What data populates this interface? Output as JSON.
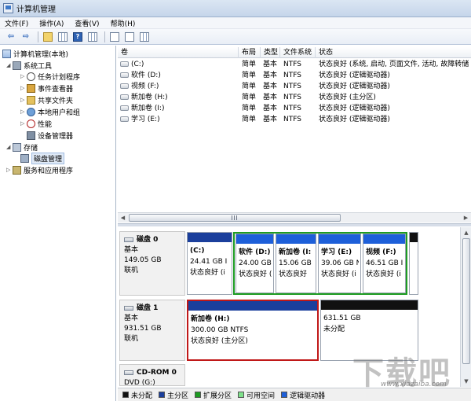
{
  "window": {
    "title": "计算机管理"
  },
  "menu": [
    "文件(F)",
    "操作(A)",
    "查看(V)",
    "帮助(H)"
  ],
  "toolbar_icons": [
    "back-arrow-icon",
    "forward-arrow-icon",
    "folder-up-icon",
    "console-tree-icon",
    "help-icon",
    "view-icon",
    "refresh-icon",
    "properties-icon",
    "settings-icon"
  ],
  "tree": {
    "root": "计算机管理(本地)",
    "system_tools": "系统工具",
    "task_scheduler": "任务计划程序",
    "event_viewer": "事件查看器",
    "shared_folders": "共享文件夹",
    "local_users": "本地用户和组",
    "performance": "性能",
    "device_manager": "设备管理器",
    "storage": "存储",
    "disk_management": "磁盘管理",
    "services_apps": "服务和应用程序"
  },
  "volume_table": {
    "headers": [
      "卷",
      "布局",
      "类型",
      "文件系统",
      "状态"
    ],
    "rows": [
      {
        "name": "(C:)",
        "layout": "简单",
        "type": "基本",
        "fs": "NTFS",
        "status": "状态良好 (系统, 启动, 页面文件, 活动, 故障转储"
      },
      {
        "name": "软件 (D:)",
        "layout": "简单",
        "type": "基本",
        "fs": "NTFS",
        "status": "状态良好 (逻辑驱动器)"
      },
      {
        "name": "视频 (F:)",
        "layout": "简单",
        "type": "基本",
        "fs": "NTFS",
        "status": "状态良好 (逻辑驱动器)"
      },
      {
        "name": "新加卷 (H:)",
        "layout": "简单",
        "type": "基本",
        "fs": "NTFS",
        "status": "状态良好 (主分区)"
      },
      {
        "name": "新加卷 (I:)",
        "layout": "简单",
        "type": "基本",
        "fs": "NTFS",
        "status": "状态良好 (逻辑驱动器)"
      },
      {
        "name": "学习 (E:)",
        "layout": "简单",
        "type": "基本",
        "fs": "NTFS",
        "status": "状态良好 (逻辑驱动器)"
      }
    ]
  },
  "disks": {
    "disk0": {
      "name": "磁盘 0",
      "type": "基本",
      "size": "149.05 GB",
      "state": "联机",
      "parts": [
        {
          "title": "(C:)",
          "size": "24.41 GB I",
          "status": "状态良好 (i"
        },
        {
          "title": "软件  (D:)",
          "size": "24.00 GB",
          "status": "状态良好 (i"
        },
        {
          "title": "新加卷  (I:",
          "size": "15.06 GB",
          "status": "状态良好"
        },
        {
          "title": "学习  (E:)",
          "size": "39.06 GB N",
          "status": "状态良好 (i"
        },
        {
          "title": "视频  (F:)",
          "size": "46.51 GB I",
          "status": "状态良好 (i"
        },
        {
          "title": "",
          "size": "",
          "status": ""
        }
      ]
    },
    "disk1": {
      "name": "磁盘 1",
      "type": "基本",
      "size": "931.51 GB",
      "state": "联机",
      "parts": [
        {
          "title": "新加卷  (H:)",
          "size": "300.00 GB NTFS",
          "status": "状态良好 (主分区)"
        },
        {
          "title": "",
          "size": "631.51 GB",
          "status": "未分配"
        }
      ]
    },
    "cdrom": {
      "name": "CD-ROM 0",
      "drive": "DVD (G:)"
    }
  },
  "legend": [
    {
      "label": "未分配",
      "color": "#111111"
    },
    {
      "label": "主分区",
      "color": "#1b3f9c"
    },
    {
      "label": "扩展分区",
      "color": "#1d9c22"
    },
    {
      "label": "可用空间",
      "color": "#7ee08a"
    },
    {
      "label": "逻辑驱动器",
      "color": "#1d5fd9"
    }
  ],
  "watermark": {
    "logo": "下载吧",
    "url": "www.xiazaiba.com"
  }
}
